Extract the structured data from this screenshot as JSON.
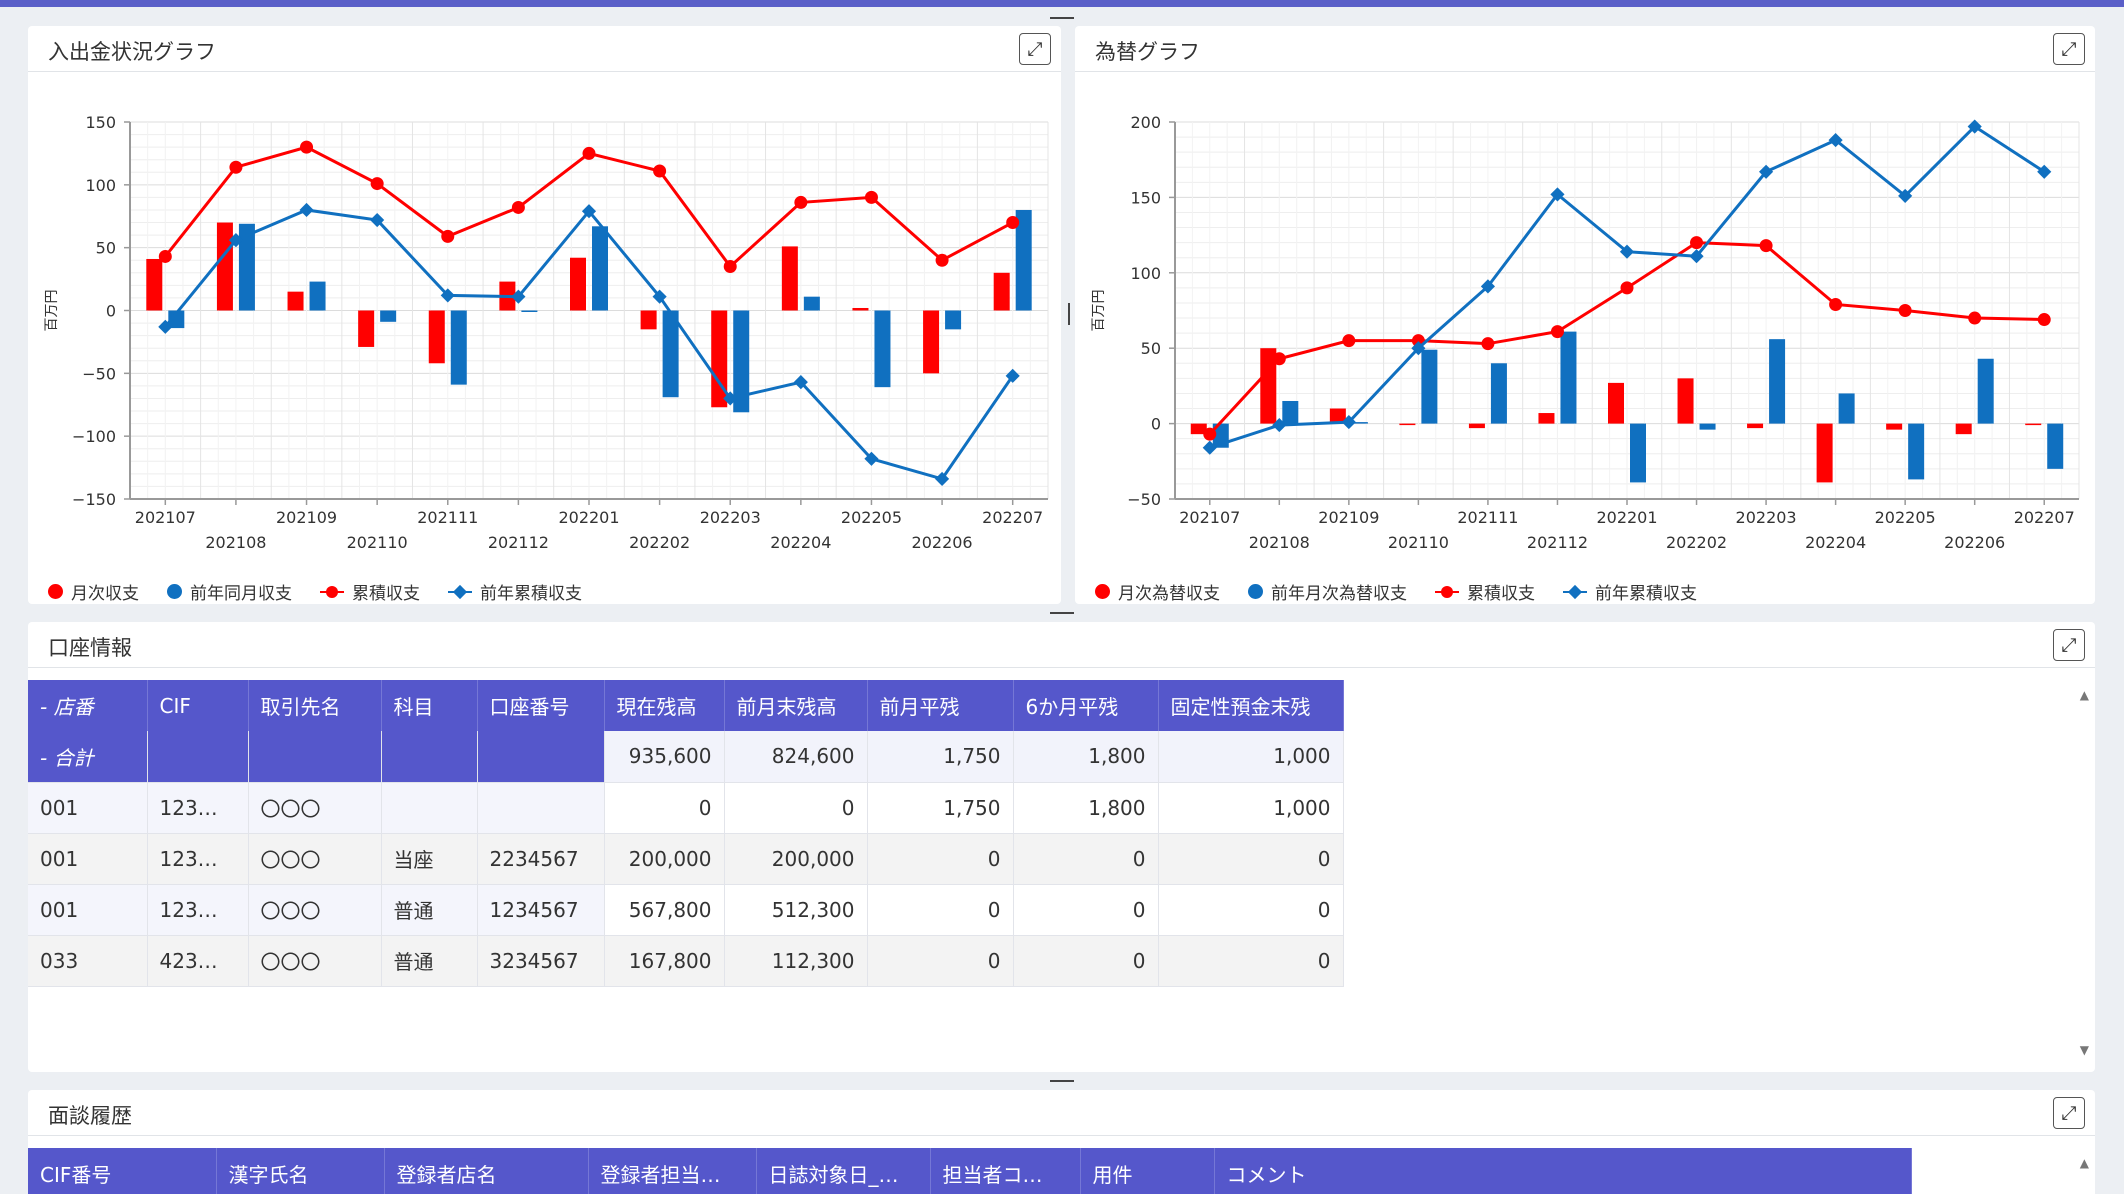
{
  "cash_chart": {
    "title": "入出金状況グラフ",
    "expand_icon": "expand-icon",
    "legend": [
      "月次収支",
      "前年同月収支",
      "累積収支",
      "前年累積収支"
    ],
    "colors": {
      "red": "#ff0000",
      "blue": "#1070c0"
    },
    "chart_data": {
      "type": "bar+line",
      "categories": [
        "202107",
        "202108",
        "202109",
        "202110",
        "202111",
        "202112",
        "202201",
        "202202",
        "202203",
        "202204",
        "202205",
        "202206",
        "202207"
      ],
      "ylabel": "百万円",
      "ylim": [
        -150,
        150
      ],
      "yticks": [
        "150",
        "100",
        "50",
        "0",
        "−50",
        "−100",
        "−150"
      ],
      "series": [
        {
          "name": "月次収支",
          "type": "bar",
          "color": "#ff0000",
          "values": [
            41,
            70,
            15,
            -29,
            -42,
            23,
            42,
            -15,
            -77,
            51,
            2,
            -50,
            30
          ]
        },
        {
          "name": "前年同月収支",
          "type": "bar",
          "color": "#1070c0",
          "values": [
            -14,
            69,
            23,
            -9,
            -59,
            -1,
            67,
            -69,
            -81,
            11,
            -61,
            -15,
            80
          ]
        },
        {
          "name": "累積収支",
          "type": "line",
          "color": "#ff0000",
          "values": [
            43,
            114,
            130,
            101,
            59,
            82,
            125,
            111,
            35,
            86,
            90,
            40,
            70
          ]
        },
        {
          "name": "前年累積収支",
          "type": "line",
          "color": "#1070c0",
          "values": [
            -13,
            56,
            80,
            72,
            12,
            11,
            79,
            11,
            -70,
            -57,
            -118,
            -134,
            -52
          ]
        }
      ]
    }
  },
  "fx_chart": {
    "title": "為替グラフ",
    "expand_icon": "expand-icon",
    "legend": [
      "月次為替収支",
      "前年月次為替収支",
      "累積収支",
      "前年累積収支"
    ],
    "chart_data": {
      "type": "bar+line",
      "categories": [
        "202107",
        "202108",
        "202109",
        "202110",
        "202111",
        "202112",
        "202201",
        "202202",
        "202203",
        "202204",
        "202205",
        "202206",
        "202207"
      ],
      "ylabel": "百万円",
      "ylim": [
        -50,
        200
      ],
      "yticks": [
        "200",
        "150",
        "100",
        "50",
        "0",
        "−50"
      ],
      "series": [
        {
          "name": "月次為替収支",
          "type": "bar",
          "color": "#ff0000",
          "values": [
            -7,
            50,
            10,
            0,
            -3,
            7,
            27,
            30,
            -3,
            -39,
            -4,
            -7,
            -1
          ]
        },
        {
          "name": "前年月次為替収支",
          "type": "bar",
          "color": "#1070c0",
          "values": [
            -16,
            15,
            1,
            49,
            40,
            61,
            -39,
            -4,
            56,
            20,
            -37,
            43,
            -30
          ]
        },
        {
          "name": "累積収支",
          "type": "line",
          "color": "#ff0000",
          "values": [
            -7,
            43,
            55,
            55,
            53,
            61,
            90,
            120,
            118,
            79,
            75,
            70,
            69
          ]
        },
        {
          "name": "前年累積収支",
          "type": "line",
          "color": "#1070c0",
          "values": [
            -16,
            -1,
            1,
            50,
            91,
            152,
            114,
            111,
            167,
            188,
            151,
            197,
            167
          ]
        }
      ]
    }
  },
  "account_panel": {
    "title": "口座情報",
    "columns": [
      "- 店番",
      "CIF",
      "取引先名",
      "科目",
      "口座番号",
      "現在残高",
      "前月末残高",
      "前月平残",
      "6か月平残",
      "固定性預金末残"
    ],
    "total_row": {
      "label": "- 合計",
      "values": [
        "935,600",
        "824,600",
        "1,750",
        "1,800",
        "1,000"
      ]
    },
    "rows": [
      [
        "001",
        "123…",
        "〇〇〇",
        "",
        "",
        "0",
        "0",
        "1,750",
        "1,800",
        "1,000"
      ],
      [
        "001",
        "123…",
        "〇〇〇",
        "当座",
        "2234567",
        "200,000",
        "200,000",
        "0",
        "0",
        "0"
      ],
      [
        "001",
        "123…",
        "〇〇〇",
        "普通",
        "1234567",
        "567,800",
        "512,300",
        "0",
        "0",
        "0"
      ],
      [
        "033",
        "423…",
        "〇〇〇",
        "普通",
        "3234567",
        "167,800",
        "112,300",
        "0",
        "0",
        "0"
      ]
    ]
  },
  "interview_panel": {
    "title": "面談履歴",
    "columns": [
      "CIF番号",
      "漢字氏名",
      "登録者店名",
      "登録者担当…",
      "日誌対象日_…",
      "担当者コ…",
      "用件",
      "コメント"
    ]
  }
}
